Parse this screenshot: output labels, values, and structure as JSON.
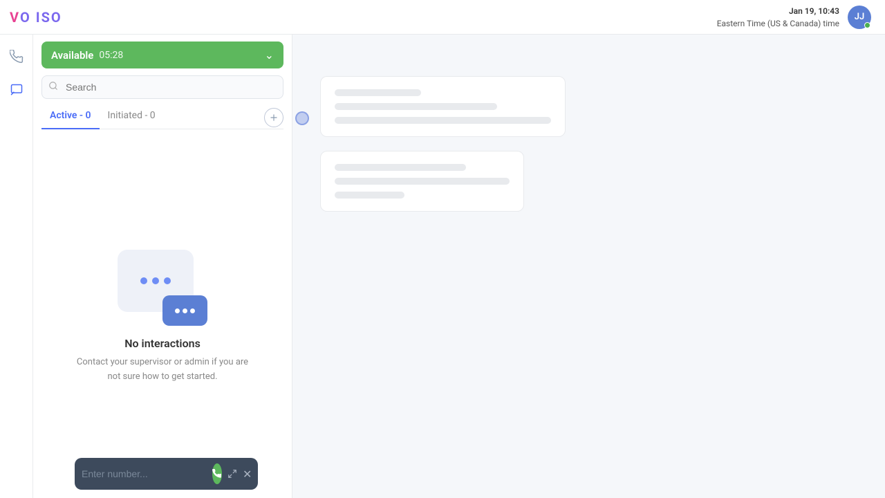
{
  "logo": {
    "v": "V",
    "o1": "O",
    "i": "I",
    "s": "S",
    "o2": "O"
  },
  "header": {
    "date": "Jan 19, 10:43",
    "timezone": "Eastern Time (US & Canada) time",
    "avatar_initials": "JJ"
  },
  "available_bar": {
    "label": "Available",
    "time": "05:28"
  },
  "search": {
    "placeholder": "Search"
  },
  "tabs": {
    "active_label": "Active - 0",
    "initiated_label": "Initiated - 0"
  },
  "empty_state": {
    "title": "No interactions",
    "description": "Contact your supervisor or admin if you are not sure how to get started."
  },
  "dial_bar": {
    "placeholder": "Enter number..."
  },
  "sidebar": {
    "icon1": "↺",
    "icon2": "▭"
  }
}
